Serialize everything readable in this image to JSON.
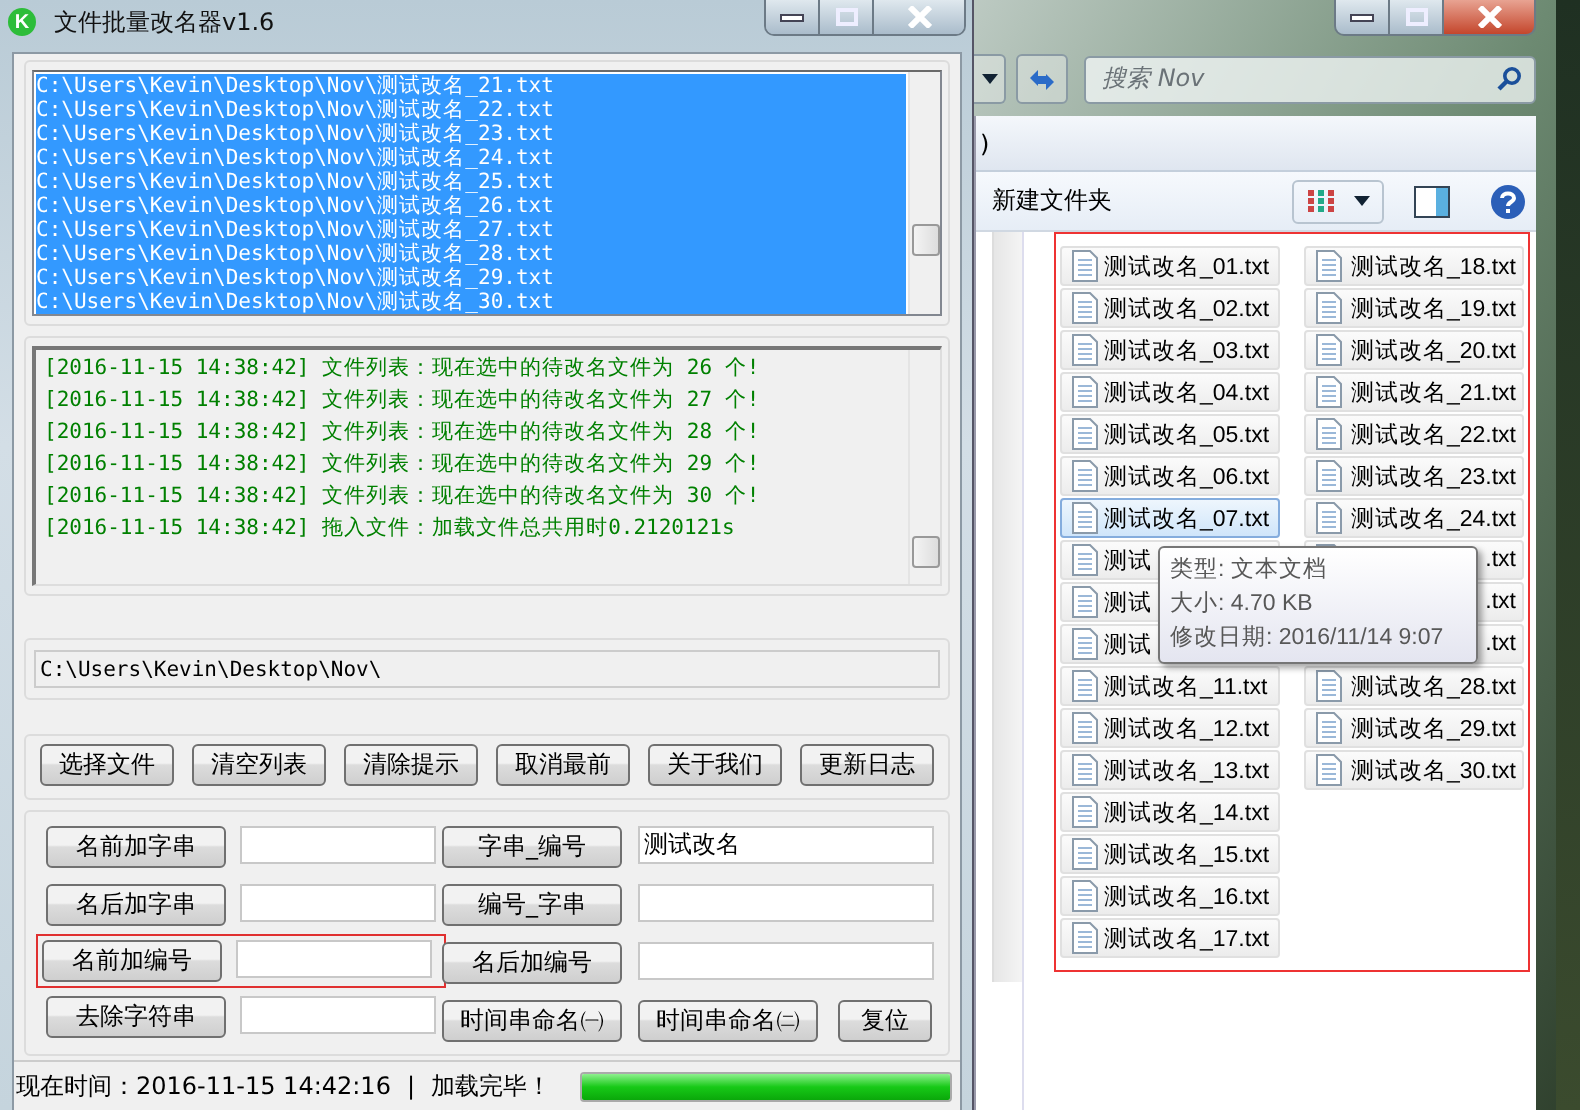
{
  "app": {
    "title": "文件批量改名器v1.6",
    "icon_letter": "K"
  },
  "file_list": {
    "items": [
      {
        "text": "C:\\Users\\Kevin\\Desktop\\Nov\\测试改名_21.txt",
        "selected": true
      },
      {
        "text": "C:\\Users\\Kevin\\Desktop\\Nov\\测试改名_22.txt",
        "selected": true
      },
      {
        "text": "C:\\Users\\Kevin\\Desktop\\Nov\\测试改名_23.txt",
        "selected": true
      },
      {
        "text": "C:\\Users\\Kevin\\Desktop\\Nov\\测试改名_24.txt",
        "selected": true
      },
      {
        "text": "C:\\Users\\Kevin\\Desktop\\Nov\\测试改名_25.txt",
        "selected": true
      },
      {
        "text": "C:\\Users\\Kevin\\Desktop\\Nov\\测试改名_26.txt",
        "selected": true
      },
      {
        "text": "C:\\Users\\Kevin\\Desktop\\Nov\\测试改名_27.txt",
        "selected": true
      },
      {
        "text": "C:\\Users\\Kevin\\Desktop\\Nov\\测试改名_28.txt",
        "selected": true
      },
      {
        "text": "C:\\Users\\Kevin\\Desktop\\Nov\\测试改名_29.txt",
        "selected": true
      },
      {
        "text": "C:\\Users\\Kevin\\Desktop\\Nov\\测试改名_30.txt",
        "selected": true
      }
    ]
  },
  "log": {
    "lines": [
      "[2016-11-15 14:38:42] 文件列表：现在选中的待改名文件为 26 个!",
      "[2016-11-15 14:38:42] 文件列表：现在选中的待改名文件为 27 个!",
      "[2016-11-15 14:38:42] 文件列表：现在选中的待改名文件为 28 个!",
      "[2016-11-15 14:38:42] 文件列表：现在选中的待改名文件为 29 个!",
      "[2016-11-15 14:38:42] 文件列表：现在选中的待改名文件为 30 个!",
      "[2016-11-15 14:38:42] 拖入文件：加载文件总共用时0.2120121s"
    ]
  },
  "path_field": {
    "value": "C:\\Users\\Kevin\\Desktop\\Nov\\"
  },
  "action_buttons": [
    "选择文件",
    "清空列表",
    "清除提示",
    "取消最前",
    "关于我们",
    "更新日志"
  ],
  "left_ops": [
    {
      "button": "名前加字串",
      "highlighted": false
    },
    {
      "button": "名后加字串",
      "highlighted": false
    },
    {
      "button": "名前加编号",
      "highlighted": true
    },
    {
      "button": "去除字符串",
      "highlighted": false
    }
  ],
  "right_ops": [
    {
      "button": "字串_编号",
      "value": "测试改名"
    },
    {
      "button": "编号_字串"
    },
    {
      "button": "名后加编号"
    }
  ],
  "bottom_buttons": [
    "时间串命名㈠",
    "时间串命名㈡",
    "复位"
  ],
  "status_bar": {
    "time": "现在时间：2016-11-15 14:42:16",
    "separator": "|",
    "message": "加载完毕！",
    "progress": {
      "level": 1
    }
  },
  "explorer": {
    "address_fragment": ")",
    "search": {
      "placeholder": "搜索 Nov"
    },
    "new_folder": "新建文件夹",
    "files_panel": {
      "highlighted": true,
      "columns": [
        [
          {
            "name": "测试改名_01.txt",
            "selected": false
          },
          {
            "name": "测试改名_02.txt",
            "selected": false
          },
          {
            "name": "测试改名_03.txt",
            "selected": false
          },
          {
            "name": "测试改名_04.txt",
            "selected": false
          },
          {
            "name": "测试改名_05.txt",
            "selected": false
          },
          {
            "name": "测试改名_06.txt",
            "selected": false
          },
          {
            "name": "测试改名_07.txt",
            "selected": true
          },
          {
            "name": "测试",
            "selected": false
          },
          {
            "name": "测试",
            "selected": false
          },
          {
            "name": "测试",
            "selected": false
          },
          {
            "name": "测试改名_11.txt",
            "selected": false
          },
          {
            "name": "测试改名_12.txt",
            "selected": false
          },
          {
            "name": "测试改名_13.txt",
            "selected": false
          },
          {
            "name": "测试改名_14.txt",
            "selected": false
          },
          {
            "name": "测试改名_15.txt",
            "selected": false
          },
          {
            "name": "测试改名_16.txt",
            "selected": false
          },
          {
            "name": "测试改名_17.txt",
            "selected": false
          }
        ],
        [
          {
            "name": "测试改名_18.txt",
            "selected": false
          },
          {
            "name": "测试改名_19.txt",
            "selected": false
          },
          {
            "name": "测试改名_20.txt",
            "selected": false
          },
          {
            "name": "测试改名_21.txt",
            "selected": false
          },
          {
            "name": "测试改名_22.txt",
            "selected": false
          },
          {
            "name": "测试改名_23.txt",
            "selected": false
          },
          {
            "name": "测试改名_24.txt",
            "selected": false
          },
          {
            "name": ".txt",
            "selected": false
          },
          {
            "name": ".txt",
            "selected": false
          },
          {
            "name": ".txt",
            "selected": false
          },
          {
            "name": "测试改名_28.txt",
            "selected": false
          },
          {
            "name": "测试改名_29.txt",
            "selected": false
          },
          {
            "name": "测试改名_30.txt",
            "selected": false
          }
        ]
      ]
    },
    "tooltip": {
      "lines": [
        "类型: 文本文档",
        "大小: 4.70 KB",
        "修改日期: 2016/11/14 9:07"
      ]
    }
  }
}
